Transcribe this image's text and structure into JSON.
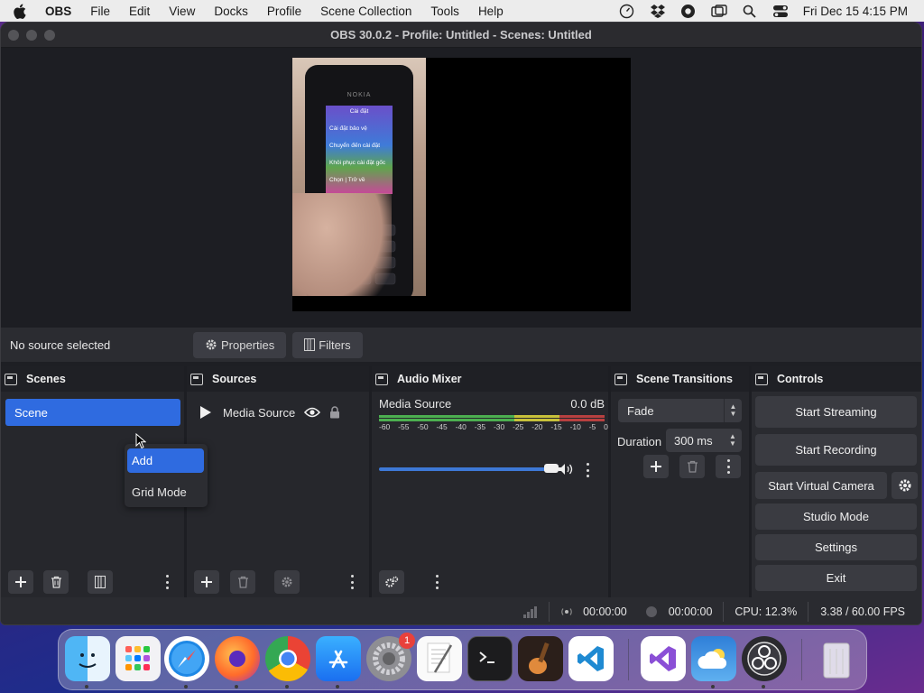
{
  "menubar": {
    "items": [
      "OBS",
      "File",
      "Edit",
      "View",
      "Docks",
      "Profile",
      "Scene Collection",
      "Tools",
      "Help"
    ],
    "clock": "Fri Dec 15  4:15 PM"
  },
  "window": {
    "title": "OBS 30.0.2 - Profile: Untitled - Scenes: Untitled"
  },
  "preview": {
    "phone_brand": "NOKIA",
    "phone_screen": [
      "Cài đặt",
      "Cài đặt bảo vệ",
      "Chuyển đến cài đặt",
      "Khôi phục cài đặt gốc",
      "Chọn  |  Trở về"
    ]
  },
  "sourcebar": {
    "status": "No source selected",
    "properties_label": "Properties",
    "filters_label": "Filters"
  },
  "scenes": {
    "title": "Scenes",
    "items": [
      "Scene"
    ],
    "context_menu": [
      "Add",
      "Grid Mode"
    ]
  },
  "sources": {
    "title": "Sources",
    "items": [
      "Media Source"
    ]
  },
  "mixer": {
    "title": "Audio Mixer",
    "channel": "Media Source",
    "level": "0.0 dB",
    "scale": [
      "-60",
      "-55",
      "-50",
      "-45",
      "-40",
      "-35",
      "-30",
      "-25",
      "-20",
      "-15",
      "-10",
      "-5",
      "0"
    ]
  },
  "transitions": {
    "title": "Scene Transitions",
    "selected": "Fade",
    "duration_label": "Duration",
    "duration_value": "300 ms"
  },
  "controls": {
    "title": "Controls",
    "start_streaming": "Start Streaming",
    "start_recording": "Start Recording",
    "start_virtual_camera": "Start Virtual Camera",
    "studio_mode": "Studio Mode",
    "settings": "Settings",
    "exit": "Exit"
  },
  "status": {
    "stream_time": "00:00:00",
    "record_time": "00:00:00",
    "cpu": "CPU: 12.3%",
    "fps": "3.38 / 60.00 FPS"
  },
  "dock": {
    "apps": [
      "Finder",
      "Launchpad",
      "Safari",
      "Firefox",
      "Chrome",
      "App Store",
      "System Settings",
      "TextEdit",
      "Terminal",
      "GarageBand",
      "Visual Studio Code",
      "Visual Studio",
      "Weather",
      "OBS",
      "Trash"
    ],
    "settings_badge": "1"
  },
  "colors": {
    "accent": "#2f6be0",
    "panel": "#2a2b30",
    "background": "#1d1e23"
  }
}
